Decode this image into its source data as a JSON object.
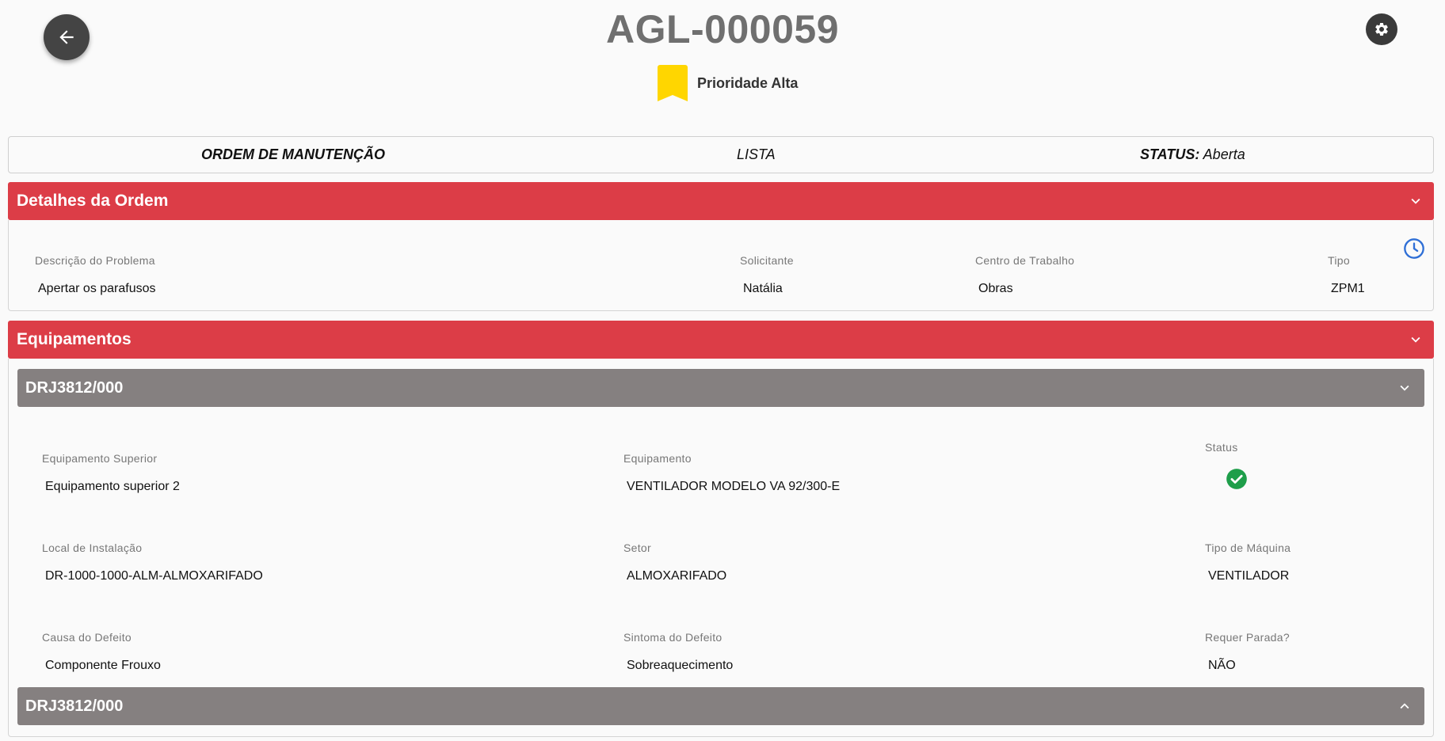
{
  "header": {
    "title": "AGL-000059",
    "priority_label": "Prioridade Alta",
    "priority_color": "#ffd600",
    "back_icon": "arrow-left-icon",
    "settings_icon": "gear-icon"
  },
  "info_bar": {
    "type_label": "ORDEM DE MANUTENÇÃO",
    "view_label": "LISTA",
    "status_key": "STATUS:",
    "status_value": "Aberta"
  },
  "order_details": {
    "title": "Detalhes da Ordem",
    "fields": [
      {
        "label": "Descrição do Problema",
        "value": "Apertar os parafusos"
      },
      {
        "label": "Solicitante",
        "value": "Natália"
      },
      {
        "label": "Centro de Trabalho",
        "value": "Obras"
      },
      {
        "label": "Tipo",
        "value": "ZPM1"
      }
    ],
    "history_icon": "clock-icon"
  },
  "equipments": {
    "title": "Equipamentos",
    "items": [
      {
        "code": "DRJ3812/000",
        "expanded": true,
        "fields": [
          {
            "label": "Equipamento Superior",
            "value": "Equipamento superior 2"
          },
          {
            "label": "Equipamento",
            "value": "VENTILADOR MODELO VA 92/300-E"
          },
          {
            "label": "Status",
            "value": "check-circle-icon"
          },
          {
            "label": "Local de Instalação",
            "value": "DR-1000-1000-ALM-ALMOXARIFADO"
          },
          {
            "label": "Setor",
            "value": "ALMOXARIFADO"
          },
          {
            "label": "Tipo de Máquina",
            "value": "VENTILADOR"
          },
          {
            "label": "Causa do Defeito",
            "value": "Componente Frouxo"
          },
          {
            "label": "Sintoma do Defeito",
            "value": "Sobreaquecimento"
          },
          {
            "label": "Requer Parada?",
            "value": "NÃO"
          }
        ]
      },
      {
        "code": "DRJ3812/000",
        "expanded": false
      }
    ]
  },
  "colors": {
    "section_header": "#dc3d47",
    "sub_header": "#858080",
    "status_ok": "#1e9e4a"
  }
}
